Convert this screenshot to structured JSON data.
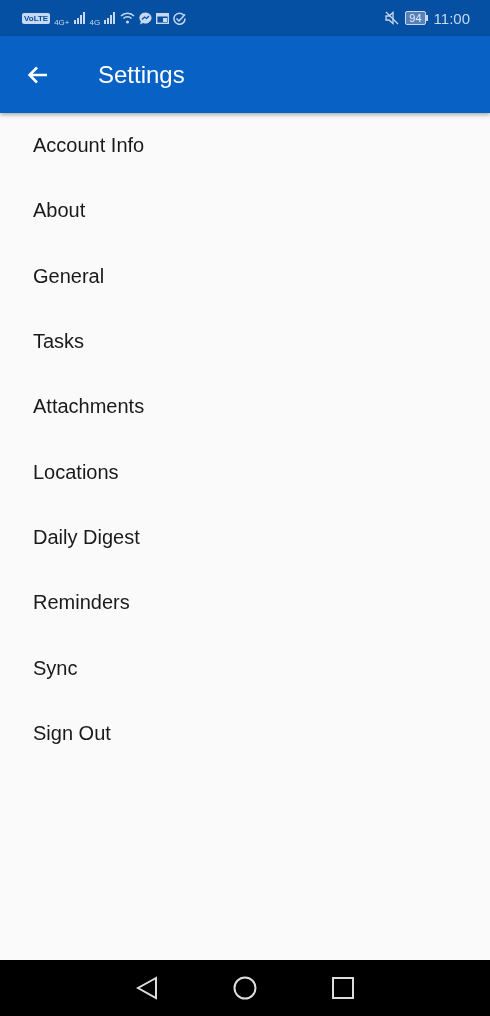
{
  "status_bar": {
    "volte": "VoLTE",
    "signal_1": "4G+",
    "signal_2": "4G",
    "battery": "94",
    "time": "11:00"
  },
  "app_bar": {
    "title": "Settings"
  },
  "items": [
    {
      "label": "Account Info"
    },
    {
      "label": "About"
    },
    {
      "label": "General"
    },
    {
      "label": "Tasks"
    },
    {
      "label": "Attachments"
    },
    {
      "label": "Locations"
    },
    {
      "label": "Daily Digest"
    },
    {
      "label": "Reminders"
    },
    {
      "label": "Sync"
    },
    {
      "label": "Sign Out"
    }
  ]
}
